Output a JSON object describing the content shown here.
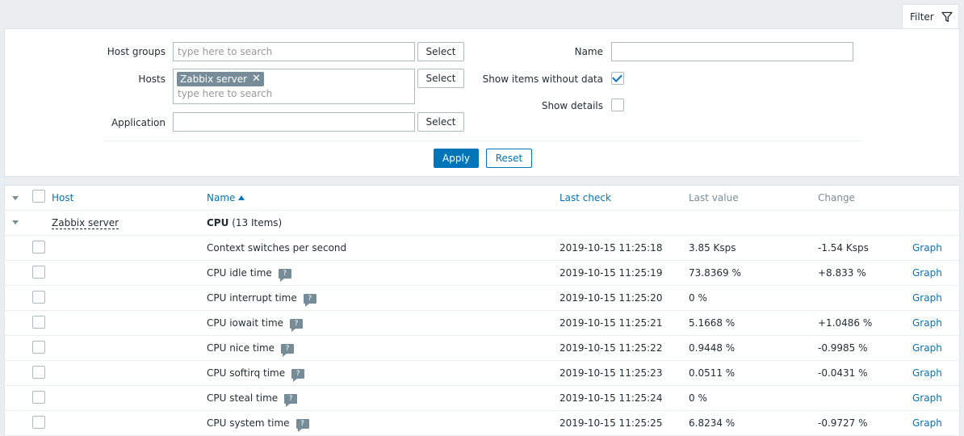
{
  "filter_tab": {
    "label": "Filter",
    "icon": "filter-icon"
  },
  "filter": {
    "host_groups_label": "Host groups",
    "host_groups_placeholder": "type here to search",
    "hosts_label": "Hosts",
    "hosts_selected": "Zabbix server",
    "hosts_placeholder": "type here to search",
    "application_label": "Application",
    "application_value": "",
    "select_label": "Select",
    "name_label": "Name",
    "name_value": "",
    "show_without_data_label": "Show items without data",
    "show_without_data_checked": true,
    "show_details_label": "Show details",
    "show_details_checked": false,
    "apply_label": "Apply",
    "reset_label": "Reset"
  },
  "table": {
    "headers": {
      "host": "Host",
      "name": "Name",
      "last_check": "Last check",
      "last_value": "Last value",
      "change": "Change"
    },
    "group": {
      "host": "Zabbix server",
      "application": "CPU",
      "count": "(13 Items)"
    },
    "rows": [
      {
        "name": "Context switches per second",
        "has_info": false,
        "last_check": "2019-10-15 11:25:18",
        "last_value": "3.85 Ksps",
        "change": "-1.54 Ksps",
        "action": "Graph"
      },
      {
        "name": "CPU idle time",
        "has_info": true,
        "last_check": "2019-10-15 11:25:19",
        "last_value": "73.8369 %",
        "change": "+8.833 %",
        "action": "Graph"
      },
      {
        "name": "CPU interrupt time",
        "has_info": true,
        "last_check": "2019-10-15 11:25:20",
        "last_value": "0 %",
        "change": "",
        "action": "Graph"
      },
      {
        "name": "CPU iowait time",
        "has_info": true,
        "last_check": "2019-10-15 11:25:21",
        "last_value": "5.1668 %",
        "change": "+1.0486 %",
        "action": "Graph"
      },
      {
        "name": "CPU nice time",
        "has_info": true,
        "last_check": "2019-10-15 11:25:22",
        "last_value": "0.9448 %",
        "change": "-0.9985 %",
        "action": "Graph"
      },
      {
        "name": "CPU softirq time",
        "has_info": true,
        "last_check": "2019-10-15 11:25:23",
        "last_value": "0.0511 %",
        "change": "-0.0431 %",
        "action": "Graph"
      },
      {
        "name": "CPU steal time",
        "has_info": true,
        "last_check": "2019-10-15 11:25:24",
        "last_value": "0 %",
        "change": "",
        "action": "Graph"
      },
      {
        "name": "CPU system time",
        "has_info": true,
        "last_check": "2019-10-15 11:25:25",
        "last_value": "6.8234 %",
        "change": "-0.9727 %",
        "action": "Graph"
      }
    ],
    "info_glyph": "?"
  },
  "colors": {
    "accent": "#0275b8",
    "muted": "#768d99",
    "border": "#acbbc2",
    "background": "#ebeef0"
  }
}
